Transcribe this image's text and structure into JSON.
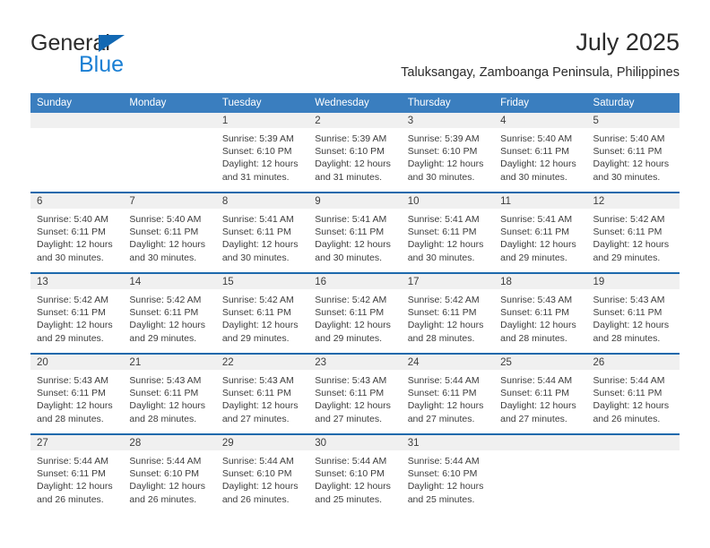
{
  "brand": {
    "name_part1": "General",
    "name_part2": "Blue",
    "logo_icon": "triangle-flag-icon",
    "color_primary": "#1a7fd4",
    "color_triangle": "#1268b3"
  },
  "header": {
    "title": "July 2025",
    "subtitle": "Taluksangay, Zamboanga Peninsula, Philippines"
  },
  "calendar": {
    "header_bg": "#3a7ebf",
    "row_divider_color": "#1d69ac",
    "day_band_bg": "#f0f0f0",
    "weekday_headers": [
      "Sunday",
      "Monday",
      "Tuesday",
      "Wednesday",
      "Thursday",
      "Friday",
      "Saturday"
    ],
    "weeks": [
      [
        {
          "day": "",
          "sunrise": "",
          "sunset": "",
          "daylight": ""
        },
        {
          "day": "",
          "sunrise": "",
          "sunset": "",
          "daylight": ""
        },
        {
          "day": "1",
          "sunrise": "Sunrise: 5:39 AM",
          "sunset": "Sunset: 6:10 PM",
          "daylight": "Daylight: 12 hours and 31 minutes."
        },
        {
          "day": "2",
          "sunrise": "Sunrise: 5:39 AM",
          "sunset": "Sunset: 6:10 PM",
          "daylight": "Daylight: 12 hours and 31 minutes."
        },
        {
          "day": "3",
          "sunrise": "Sunrise: 5:39 AM",
          "sunset": "Sunset: 6:10 PM",
          "daylight": "Daylight: 12 hours and 30 minutes."
        },
        {
          "day": "4",
          "sunrise": "Sunrise: 5:40 AM",
          "sunset": "Sunset: 6:11 PM",
          "daylight": "Daylight: 12 hours and 30 minutes."
        },
        {
          "day": "5",
          "sunrise": "Sunrise: 5:40 AM",
          "sunset": "Sunset: 6:11 PM",
          "daylight": "Daylight: 12 hours and 30 minutes."
        }
      ],
      [
        {
          "day": "6",
          "sunrise": "Sunrise: 5:40 AM",
          "sunset": "Sunset: 6:11 PM",
          "daylight": "Daylight: 12 hours and 30 minutes."
        },
        {
          "day": "7",
          "sunrise": "Sunrise: 5:40 AM",
          "sunset": "Sunset: 6:11 PM",
          "daylight": "Daylight: 12 hours and 30 minutes."
        },
        {
          "day": "8",
          "sunrise": "Sunrise: 5:41 AM",
          "sunset": "Sunset: 6:11 PM",
          "daylight": "Daylight: 12 hours and 30 minutes."
        },
        {
          "day": "9",
          "sunrise": "Sunrise: 5:41 AM",
          "sunset": "Sunset: 6:11 PM",
          "daylight": "Daylight: 12 hours and 30 minutes."
        },
        {
          "day": "10",
          "sunrise": "Sunrise: 5:41 AM",
          "sunset": "Sunset: 6:11 PM",
          "daylight": "Daylight: 12 hours and 30 minutes."
        },
        {
          "day": "11",
          "sunrise": "Sunrise: 5:41 AM",
          "sunset": "Sunset: 6:11 PM",
          "daylight": "Daylight: 12 hours and 29 minutes."
        },
        {
          "day": "12",
          "sunrise": "Sunrise: 5:42 AM",
          "sunset": "Sunset: 6:11 PM",
          "daylight": "Daylight: 12 hours and 29 minutes."
        }
      ],
      [
        {
          "day": "13",
          "sunrise": "Sunrise: 5:42 AM",
          "sunset": "Sunset: 6:11 PM",
          "daylight": "Daylight: 12 hours and 29 minutes."
        },
        {
          "day": "14",
          "sunrise": "Sunrise: 5:42 AM",
          "sunset": "Sunset: 6:11 PM",
          "daylight": "Daylight: 12 hours and 29 minutes."
        },
        {
          "day": "15",
          "sunrise": "Sunrise: 5:42 AM",
          "sunset": "Sunset: 6:11 PM",
          "daylight": "Daylight: 12 hours and 29 minutes."
        },
        {
          "day": "16",
          "sunrise": "Sunrise: 5:42 AM",
          "sunset": "Sunset: 6:11 PM",
          "daylight": "Daylight: 12 hours and 29 minutes."
        },
        {
          "day": "17",
          "sunrise": "Sunrise: 5:42 AM",
          "sunset": "Sunset: 6:11 PM",
          "daylight": "Daylight: 12 hours and 28 minutes."
        },
        {
          "day": "18",
          "sunrise": "Sunrise: 5:43 AM",
          "sunset": "Sunset: 6:11 PM",
          "daylight": "Daylight: 12 hours and 28 minutes."
        },
        {
          "day": "19",
          "sunrise": "Sunrise: 5:43 AM",
          "sunset": "Sunset: 6:11 PM",
          "daylight": "Daylight: 12 hours and 28 minutes."
        }
      ],
      [
        {
          "day": "20",
          "sunrise": "Sunrise: 5:43 AM",
          "sunset": "Sunset: 6:11 PM",
          "daylight": "Daylight: 12 hours and 28 minutes."
        },
        {
          "day": "21",
          "sunrise": "Sunrise: 5:43 AM",
          "sunset": "Sunset: 6:11 PM",
          "daylight": "Daylight: 12 hours and 28 minutes."
        },
        {
          "day": "22",
          "sunrise": "Sunrise: 5:43 AM",
          "sunset": "Sunset: 6:11 PM",
          "daylight": "Daylight: 12 hours and 27 minutes."
        },
        {
          "day": "23",
          "sunrise": "Sunrise: 5:43 AM",
          "sunset": "Sunset: 6:11 PM",
          "daylight": "Daylight: 12 hours and 27 minutes."
        },
        {
          "day": "24",
          "sunrise": "Sunrise: 5:44 AM",
          "sunset": "Sunset: 6:11 PM",
          "daylight": "Daylight: 12 hours and 27 minutes."
        },
        {
          "day": "25",
          "sunrise": "Sunrise: 5:44 AM",
          "sunset": "Sunset: 6:11 PM",
          "daylight": "Daylight: 12 hours and 27 minutes."
        },
        {
          "day": "26",
          "sunrise": "Sunrise: 5:44 AM",
          "sunset": "Sunset: 6:11 PM",
          "daylight": "Daylight: 12 hours and 26 minutes."
        }
      ],
      [
        {
          "day": "27",
          "sunrise": "Sunrise: 5:44 AM",
          "sunset": "Sunset: 6:11 PM",
          "daylight": "Daylight: 12 hours and 26 minutes."
        },
        {
          "day": "28",
          "sunrise": "Sunrise: 5:44 AM",
          "sunset": "Sunset: 6:10 PM",
          "daylight": "Daylight: 12 hours and 26 minutes."
        },
        {
          "day": "29",
          "sunrise": "Sunrise: 5:44 AM",
          "sunset": "Sunset: 6:10 PM",
          "daylight": "Daylight: 12 hours and 26 minutes."
        },
        {
          "day": "30",
          "sunrise": "Sunrise: 5:44 AM",
          "sunset": "Sunset: 6:10 PM",
          "daylight": "Daylight: 12 hours and 25 minutes."
        },
        {
          "day": "31",
          "sunrise": "Sunrise: 5:44 AM",
          "sunset": "Sunset: 6:10 PM",
          "daylight": "Daylight: 12 hours and 25 minutes."
        },
        {
          "day": "",
          "sunrise": "",
          "sunset": "",
          "daylight": ""
        },
        {
          "day": "",
          "sunrise": "",
          "sunset": "",
          "daylight": ""
        }
      ]
    ]
  }
}
